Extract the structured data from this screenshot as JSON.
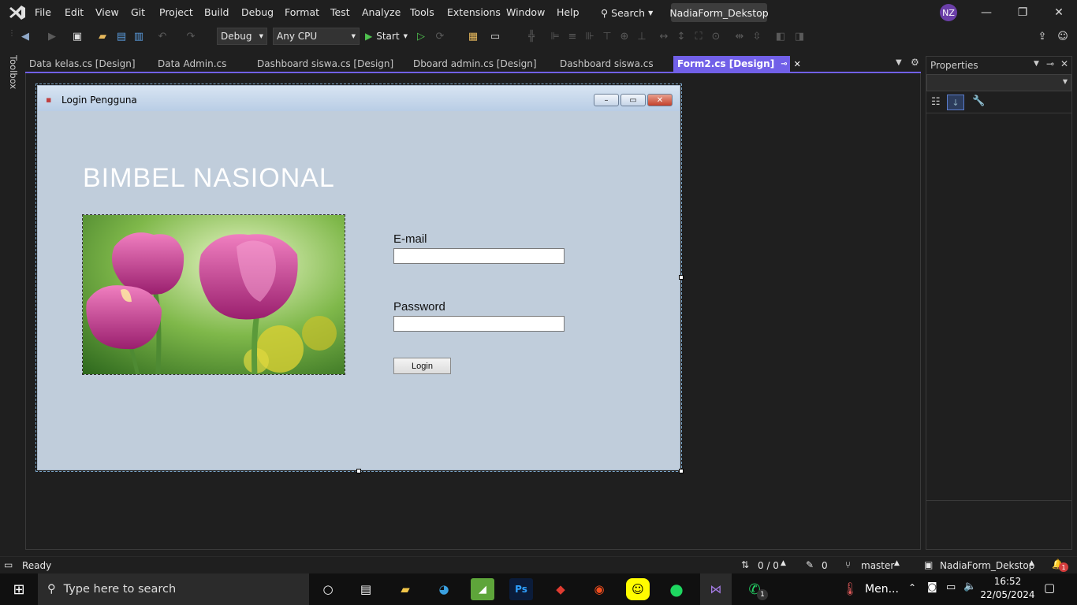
{
  "menubar": {
    "items": [
      "File",
      "Edit",
      "View",
      "Git",
      "Project",
      "Build",
      "Debug",
      "Format",
      "Test",
      "Analyze",
      "Tools",
      "Extensions",
      "Window",
      "Help"
    ],
    "search": "Search",
    "project_title": "NadiaForm_Dekstop",
    "avatar": "NZ"
  },
  "toolbar": {
    "config": "Debug",
    "platform": "Any CPU",
    "start": "Start"
  },
  "toolbox": {
    "label": "Toolbox"
  },
  "tabs": [
    "Data kelas.cs [Design]",
    "Data Admin.cs",
    "Dashboard siswa.cs [Design]",
    "Dboard admin.cs [Design]",
    "Dashboard siswa.cs",
    "Form2.cs [Design]"
  ],
  "form": {
    "title": "Login Pengguna",
    "heading": "BIMBEL NASIONAL",
    "email_label": "E-mail",
    "password_label": "Password",
    "login_button": "Login"
  },
  "properties": {
    "title": "Properties"
  },
  "statusbar": {
    "status": "Ready",
    "changes": "0 / 0",
    "pencil": "0",
    "branch": "master",
    "project": "NadiaForm_Dekstop",
    "notifications": "1"
  },
  "taskbar": {
    "search_placeholder": "Type here to search",
    "weather": "Men...",
    "time": "16:52",
    "date": "22/05/2024",
    "whatsapp_badge": "1"
  },
  "colors": {
    "accent": "#7160e8",
    "form_bg": "#c0cddb",
    "ide_bg": "#1f1f1f"
  }
}
